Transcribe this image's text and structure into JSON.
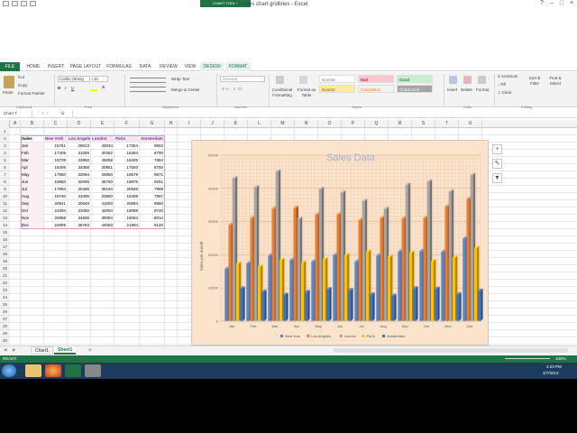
{
  "window": {
    "title": "80 sales chart gridlines - Excel",
    "user": "Mcarteyll"
  },
  "context_tab": "CHART TOOLS",
  "tabs": [
    "FILE",
    "HOME",
    "INSERT",
    "PAGE LAYOUT",
    "FORMULAS",
    "DATA",
    "REVIEW",
    "VIEW",
    "DESIGN",
    "FORMAT"
  ],
  "ribbon": {
    "paste": "Paste",
    "cut": "Cut",
    "copy": "Copy",
    "format_painter": "Format Painter",
    "font_name": "Calibri (Body)",
    "font_size": "10",
    "wrap_text": "Wrap Text",
    "merge": "Merge & Center",
    "number_format": "General",
    "cond_format": "Conditional Formatting",
    "format_as_table": "Format as Table",
    "styles": {
      "normal": "Normal",
      "bad": "Bad",
      "good": "Good",
      "neutral": "Neutral",
      "calculation": "Calculation",
      "check_cell": "Check Cell"
    },
    "insert": "Insert",
    "delete": "Delete",
    "format": "Format",
    "autosum": "AutoSum",
    "fill": "Fill",
    "clear": "Clear",
    "sort_filter": "Sort & Filter",
    "find_select": "Find & Select",
    "groups": {
      "clipboard": "Clipboard",
      "font": "Font",
      "alignment": "Alignment",
      "number": "Number",
      "styles": "Styles",
      "cells": "Cells",
      "editing": "Editing"
    }
  },
  "name_box": "Chart 7",
  "fx": "fx",
  "columns": [
    "A",
    "B",
    "C",
    "D",
    "E",
    "F",
    "G",
    "H",
    "I",
    "J",
    "K",
    "L",
    "M",
    "N",
    "O",
    "P",
    "Q",
    "R",
    "S",
    "T",
    "U"
  ],
  "rows": [
    "1",
    "2",
    "3",
    "4",
    "5",
    "6",
    "7",
    "8",
    "9",
    "10",
    "11",
    "12",
    "13",
    "14",
    "15",
    "16",
    "17",
    "18",
    "19",
    "20",
    "21",
    "22",
    "23",
    "24",
    "25",
    "26",
    "27",
    "28",
    "29",
    "30",
    "31"
  ],
  "table": {
    "headers": [
      "Sales",
      "New York",
      "Los Angeles",
      "London",
      "Paris",
      "Amsterdam"
    ],
    "rows": [
      [
        "Jan",
        "15761",
        "29013",
        "43034",
        "17304",
        "9802"
      ],
      [
        "Feb",
        "17405",
        "31059",
        "40362",
        "16394",
        "8790"
      ],
      [
        "Mar",
        "19739",
        "33850",
        "45058",
        "18405",
        "7894"
      ],
      [
        "Apr",
        "18405",
        "34058",
        "30851",
        "17593",
        "8750"
      ],
      [
        "May",
        "17950",
        "32094",
        "39850",
        "18579",
        "9571"
      ],
      [
        "Jun",
        "19850",
        "32095",
        "38750",
        "19875",
        "9251"
      ],
      [
        "Jul",
        "17894",
        "30485",
        "36194",
        "20948",
        "7998"
      ],
      [
        "Aug",
        "19740",
        "31085",
        "33850",
        "19408",
        "7597"
      ],
      [
        "Sep",
        "20941",
        "30948",
        "41093",
        "20594",
        "9850"
      ],
      [
        "Oct",
        "21094",
        "31092",
        "42094",
        "18059",
        "9740"
      ],
      [
        "Nov",
        "20858",
        "34506",
        "39084",
        "19084",
        "8014"
      ],
      [
        "Dec",
        "24905",
        "36783",
        "44093",
        "21984",
        "9120"
      ]
    ]
  },
  "chart_data": {
    "type": "bar",
    "title": "Sales Data",
    "ylabel": "Sales per month",
    "xlabel": "",
    "categories": [
      "Jan",
      "Feb",
      "Mar",
      "Apr",
      "May",
      "Jun",
      "Jul",
      "Aug",
      "Sep",
      "Oct",
      "Nov",
      "Dec"
    ],
    "ylim": [
      0,
      50000
    ],
    "yticks": [
      "0",
      "10000",
      "20000",
      "30000",
      "40000",
      "50000"
    ],
    "legend": "bottom",
    "series": [
      {
        "name": "New York",
        "color": "#5b87c9",
        "values": [
          15761,
          17405,
          19739,
          18405,
          17950,
          19850,
          17894,
          19740,
          20941,
          21094,
          20858,
          24905
        ]
      },
      {
        "name": "Los Angeles",
        "color": "#ed7d31",
        "values": [
          29013,
          31059,
          33850,
          34058,
          32094,
          32095,
          30485,
          31085,
          30948,
          31092,
          34506,
          36783
        ]
      },
      {
        "name": "London",
        "color": "#a5a5a5",
        "values": [
          43034,
          40362,
          45058,
          30851,
          39850,
          38750,
          36194,
          33850,
          41093,
          42094,
          39084,
          44093
        ]
      },
      {
        "name": "Paris",
        "color": "#ffc000",
        "values": [
          17304,
          16394,
          18405,
          17593,
          18579,
          19875,
          20948,
          19408,
          20594,
          18059,
          19084,
          21984
        ]
      },
      {
        "name": "Amsterdam",
        "color": "#4472c4",
        "values": [
          9802,
          8790,
          7894,
          8750,
          9571,
          9251,
          7998,
          7597,
          9850,
          9740,
          8014,
          9120
        ]
      }
    ]
  },
  "sheet_tabs": [
    "Chart1",
    "Sheet1"
  ],
  "active_sheet": "Sheet1",
  "status": {
    "ready": "READY",
    "zoom": "100%"
  },
  "taskbar": {
    "time": "4:23 PM",
    "date": "4/7/2013"
  }
}
